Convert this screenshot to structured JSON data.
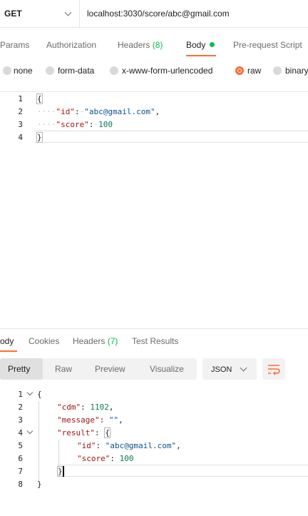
{
  "request": {
    "method": "GET",
    "url": "localhost:3030/score/abc@gmail.com"
  },
  "request_tabs": {
    "params": "Params",
    "authorization": "Authorization",
    "headers": "Headers",
    "headers_count": "(8)",
    "body": "Body",
    "prerequest": "Pre-request Script"
  },
  "body_modes": {
    "none": "none",
    "form_data": "form-data",
    "urlencoded": "x-www-form-urlencoded",
    "raw": "raw",
    "binary": "binary",
    "selected": "raw"
  },
  "request_body": {
    "line_numbers": [
      "1",
      "2",
      "3",
      "4"
    ],
    "open_brace": "{",
    "close_brace": "}",
    "id_key": "\"id\"",
    "id_value": "\"abc@gmail.com\"",
    "score_key": "\"score\"",
    "score_value": "100",
    "colon": ":",
    "comma": ","
  },
  "response_tabs": {
    "body": "Body",
    "cookies": "Cookies",
    "headers": "Headers",
    "headers_count": "(7)",
    "test_results": "Test Results"
  },
  "view_modes": {
    "pretty": "Pretty",
    "raw": "Raw",
    "preview": "Preview",
    "visualize": "Visualize",
    "format": "JSON"
  },
  "response_body": {
    "line_numbers": [
      "1",
      "2",
      "3",
      "4",
      "5",
      "6",
      "7",
      "8"
    ],
    "open_brace": "{",
    "close_brace": "}",
    "cdm_key": "\"cdm\"",
    "cdm_value": "1102",
    "message_key": "\"message\"",
    "message_value": "\"\"",
    "result_key": "\"result\"",
    "id_key": "\"id\"",
    "id_value": "\"abc@gmail.com\"",
    "score_key": "\"score\"",
    "score_value": "100",
    "colon": ":",
    "comma": ","
  },
  "colors": {
    "accent": "#ff6c37",
    "success": "#0cbb52"
  }
}
